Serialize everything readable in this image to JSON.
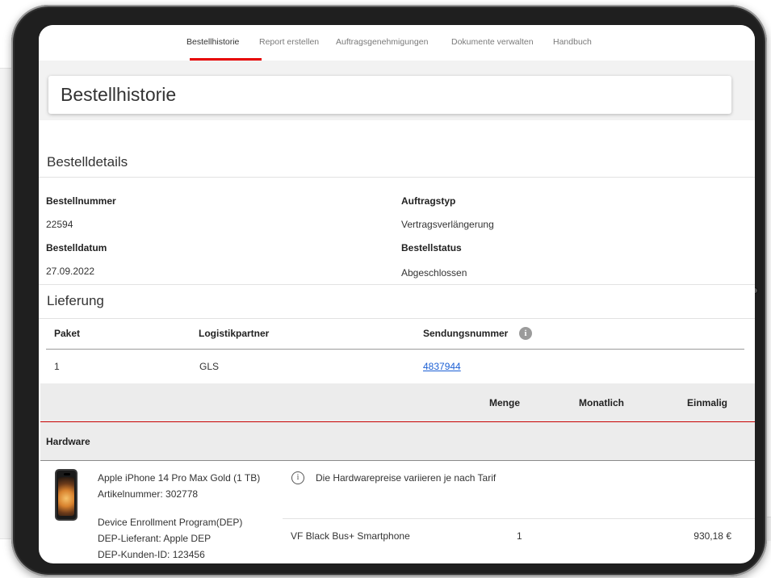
{
  "nav": {
    "tabs": [
      {
        "label": "Bestellhistorie",
        "active": true
      },
      {
        "label": "Report erstellen",
        "active": false
      },
      {
        "label": "Auftragsgenehmigungen",
        "active": false
      },
      {
        "label": "Dokumente verwalten",
        "active": false
      },
      {
        "label": "Handbuch",
        "active": false
      }
    ]
  },
  "page": {
    "title": "Bestellhistorie"
  },
  "details": {
    "section_title": "Bestelldetails",
    "order_number_label": "Bestellnummer",
    "order_number": "22594",
    "order_type_label": "Auftragstyp",
    "order_type": "Vertragsverlängerung",
    "order_date_label": "Bestelldatum",
    "order_date": "27.09.2022",
    "order_status_label": "Bestellstatus",
    "order_status": "Abgeschlossen"
  },
  "delivery": {
    "section_title": "Lieferung",
    "columns": [
      "Paket",
      "Logistikpartner",
      "Sendungsnummer"
    ],
    "info_icon": "i",
    "rows": [
      {
        "paket": "1",
        "partner": "GLS",
        "tracking": "4837944"
      }
    ]
  },
  "items": {
    "columns": [
      "Menge",
      "Monatlich",
      "Einmalig"
    ],
    "group": "Hardware",
    "product": {
      "name": "Apple iPhone 14 Pro Max Gold (1 TB)",
      "article": "Artikelnummer: 302778",
      "dep_title": "Device Enrollment Program(DEP)",
      "dep_supplier": "DEP-Lieferant: Apple DEP",
      "dep_customer": "DEP-Kunden-ID: 123456",
      "price_note_icon": "i",
      "price_note": "Die Hardwarepreise variieren je nach Tarif",
      "tariff": "VF Black Bus+ Smartphone",
      "quantity": "1",
      "monthly": "",
      "once": "930,18 €"
    }
  },
  "colors": {
    "accent": "#e60000",
    "link": "#1b5fd4"
  }
}
